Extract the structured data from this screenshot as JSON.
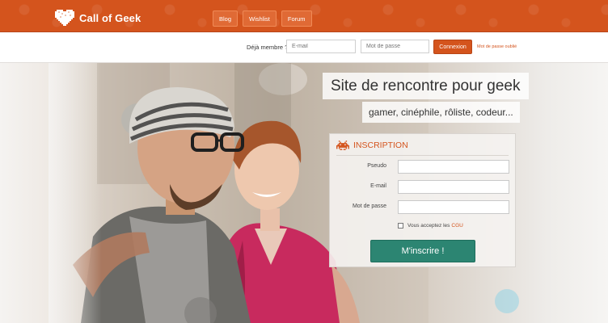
{
  "brand": {
    "name": "Call of Geek"
  },
  "nav": {
    "items": [
      {
        "label": "Blog"
      },
      {
        "label": "Wishlist"
      },
      {
        "label": "Forum"
      }
    ]
  },
  "login": {
    "member_label": "Déjà membre ?",
    "email_placeholder": "E-mail",
    "password_placeholder": "Mot de passe",
    "button_label": "Connexion",
    "forgot_link": "Mot de passe oublié"
  },
  "hero": {
    "headline": "Site de rencontre pour geek",
    "subline": "gamer, cinéphile, rôliste, codeur..."
  },
  "signup": {
    "title": "INSCRIPTION",
    "fields": [
      {
        "label": "Pseudo",
        "value": ""
      },
      {
        "label": "E-mail",
        "value": ""
      },
      {
        "label": "Mot de passe",
        "value": ""
      }
    ],
    "terms_text": "Vous acceptez les",
    "terms_link": "CGU",
    "submit_label": "M'inscrire !"
  },
  "colors": {
    "brand_orange": "#d4541d",
    "accent_green": "#2c8572",
    "header_bg": "#d4541d"
  },
  "icons": {
    "logo": "pixel-heart-icon",
    "signup": "space-invader-icon"
  }
}
